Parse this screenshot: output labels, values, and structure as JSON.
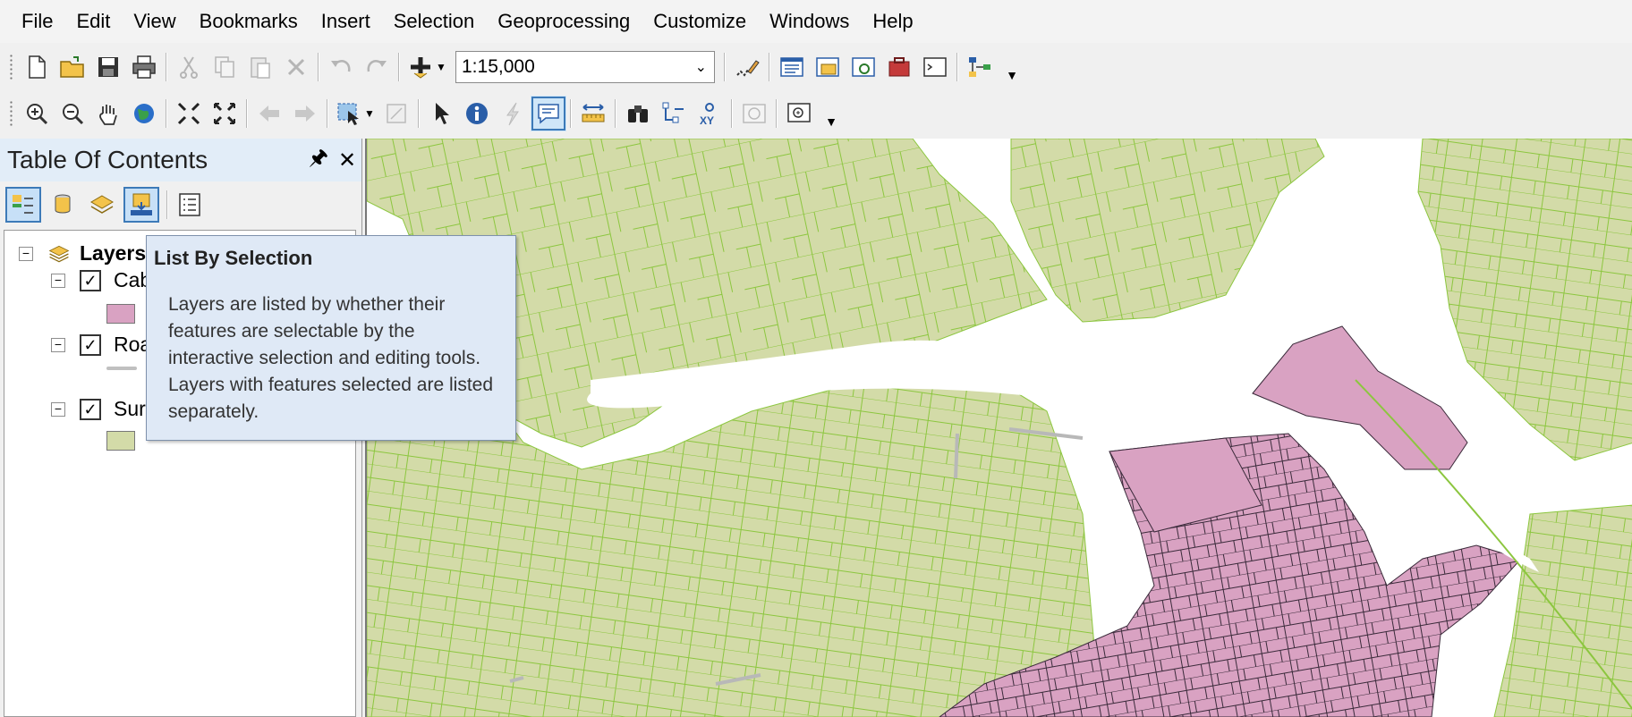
{
  "menu": [
    "File",
    "Edit",
    "View",
    "Bookmarks",
    "Insert",
    "Selection",
    "Geoprocessing",
    "Customize",
    "Windows",
    "Help"
  ],
  "standard_toolbar": {
    "scale": "1:15,000"
  },
  "toc": {
    "title": "Table Of Contents",
    "root_label": "Layers",
    "layers": [
      {
        "label": "Cab",
        "checked": true,
        "legend": "fill-swatch",
        "color": "#d9a2c2"
      },
      {
        "label": "Roa",
        "checked": true,
        "legend": "line-swatch",
        "color": "#c0c0c0"
      },
      {
        "label": "Sur",
        "checked": true,
        "legend": "fill-swatch",
        "color": "#d3dba8"
      }
    ],
    "pin_icon": "pin-icon",
    "close_icon": "close-icon"
  },
  "tooltip": {
    "title": "List By Selection",
    "body": "Layers are listed by whether their features are selectable by the interactive selection and editing tools. Layers with features selected are listed separately."
  },
  "map": {
    "parcel_color": "#d3dba8",
    "parcel_outline": "#8cc63f",
    "selected_color": "#d9a2c2",
    "selected_outline": "#3a2a3a",
    "road_color": "#b8b8b8",
    "background": "#ffffff"
  }
}
